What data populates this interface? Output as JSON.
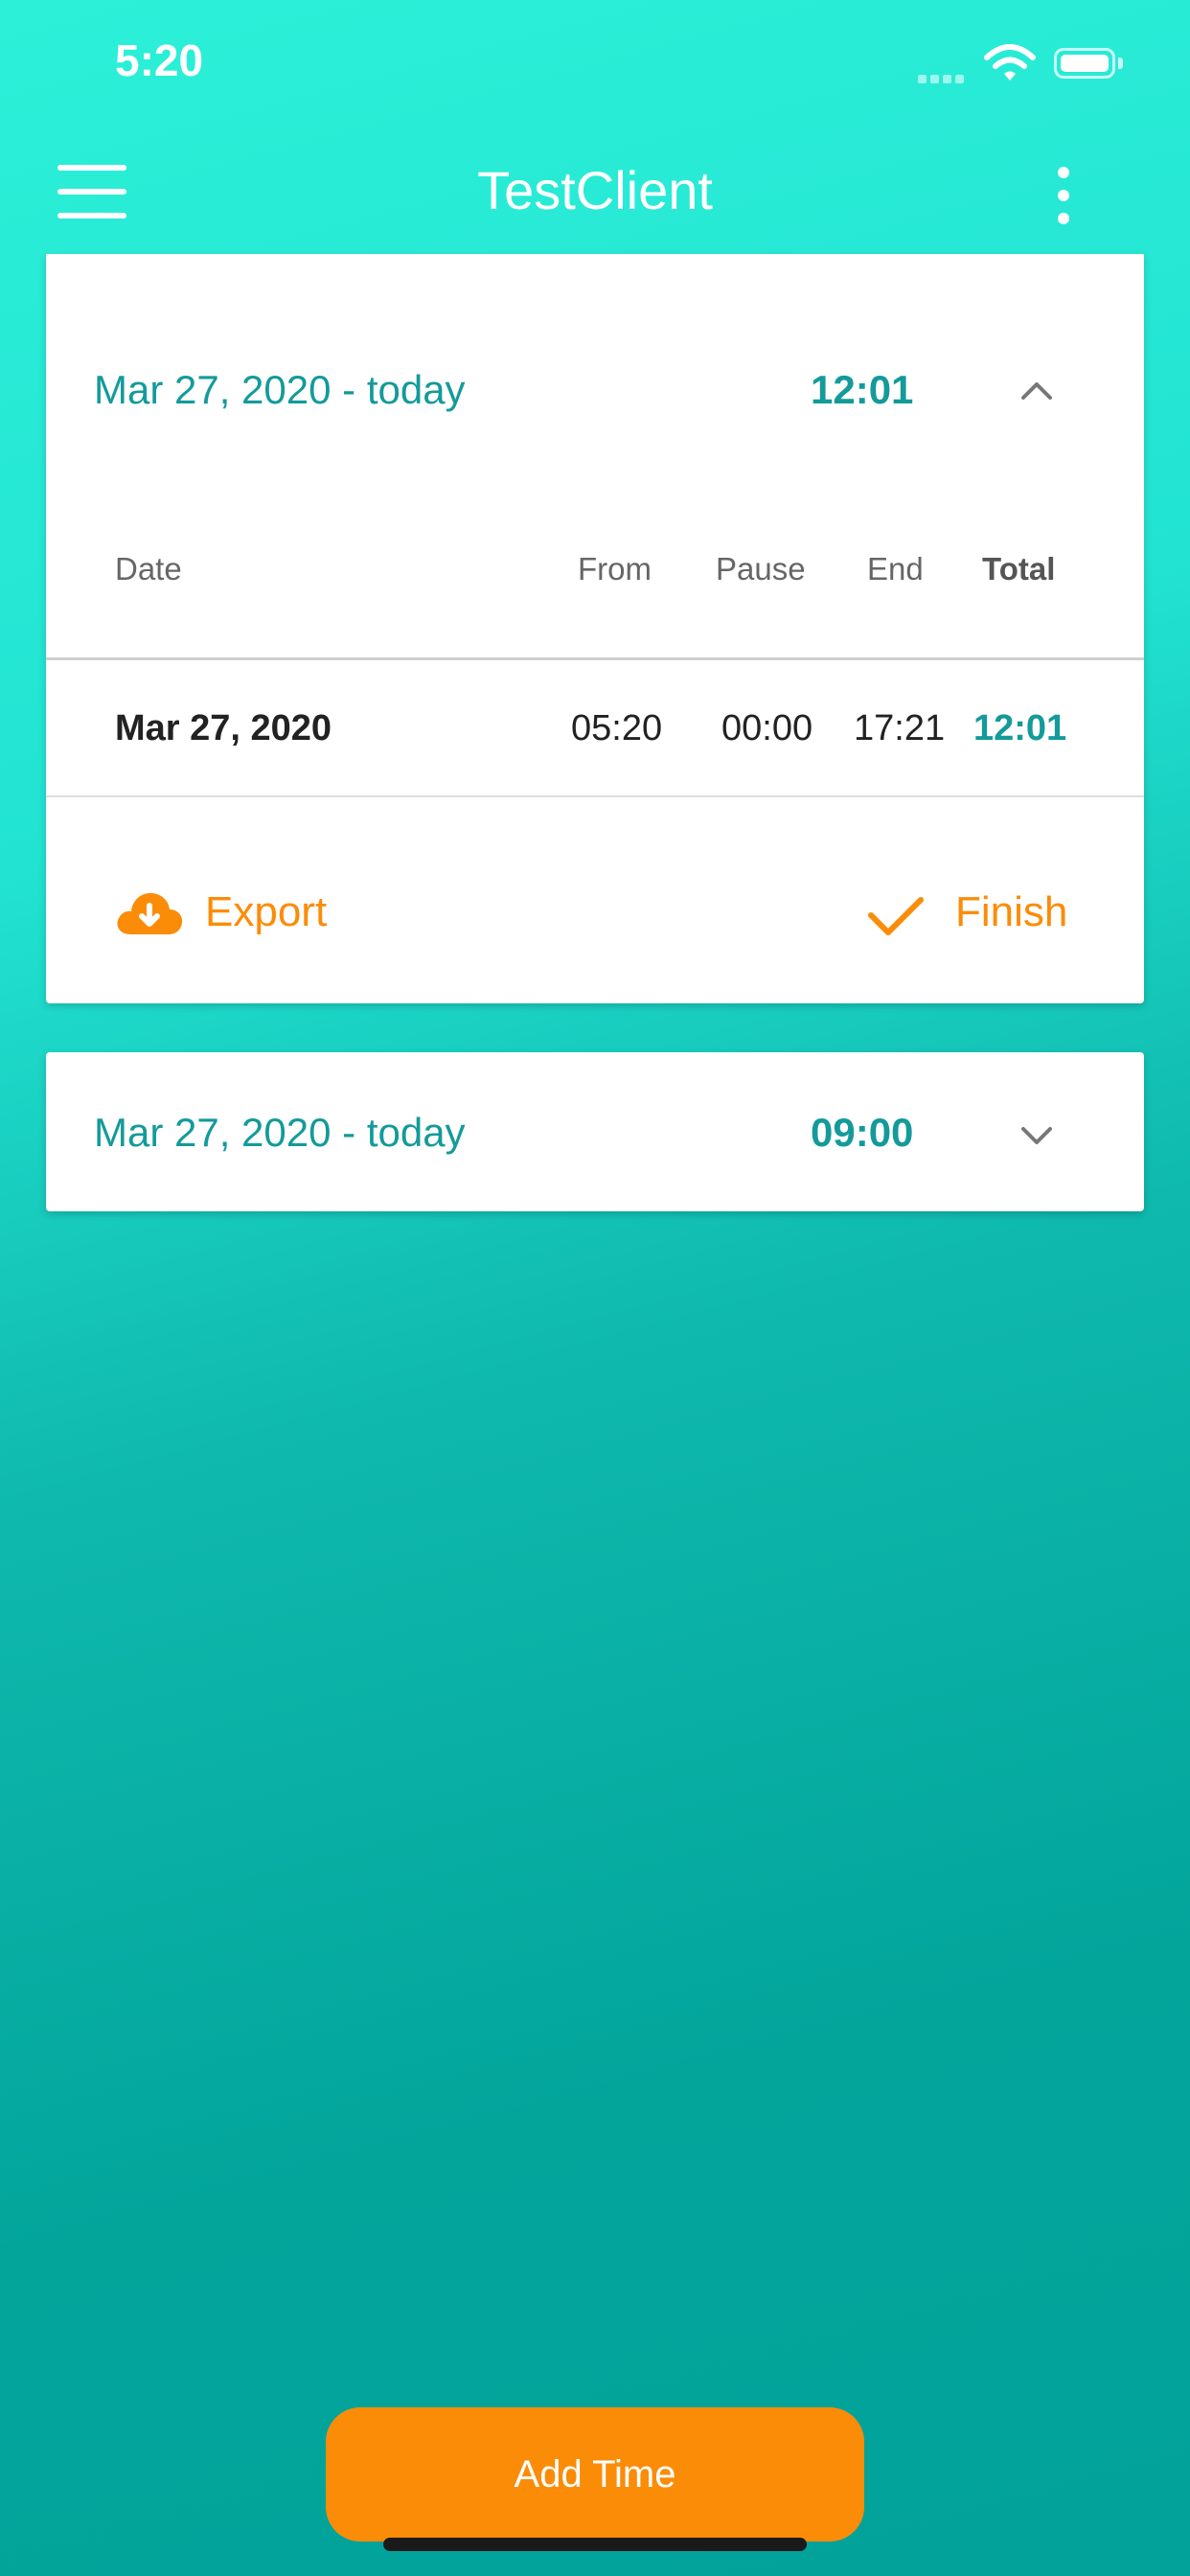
{
  "status_bar": {
    "time": "5:20"
  },
  "app_bar": {
    "title": "TestClient"
  },
  "cards": [
    {
      "range": "Mar 27, 2020 - today",
      "total": "12:01",
      "expanded": true,
      "columns": {
        "date": "Date",
        "from": "From",
        "pause": "Pause",
        "end": "End",
        "total": "Total"
      },
      "rows": [
        {
          "date": "Mar 27, 2020",
          "from": "05:20",
          "pause": "00:00",
          "end": "17:21",
          "total": "12:01"
        }
      ],
      "actions": {
        "export": "Export",
        "finish": "Finish"
      }
    },
    {
      "range": "Mar 27, 2020 - today",
      "total": "09:00",
      "expanded": false
    }
  ],
  "add_button": "Add Time",
  "colors": {
    "accent": "#fb8c08",
    "teal_text": "#149a9a",
    "background_top": "#2cf0d8",
    "background_bottom": "#02a29a"
  }
}
